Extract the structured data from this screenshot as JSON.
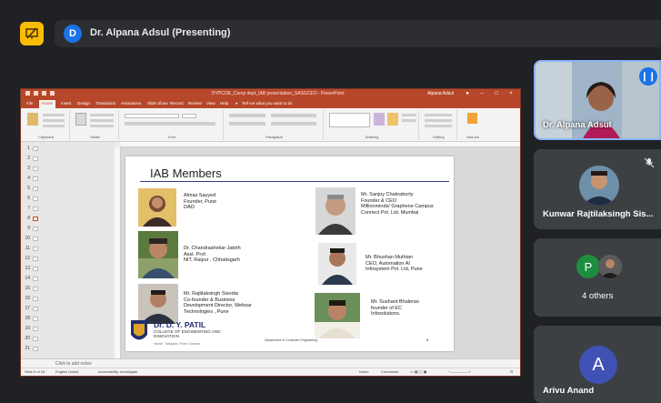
{
  "meeting": {
    "presenter_initial": "D",
    "presenter_label": "Dr. Alpana Adsul (Presenting)",
    "accent_color": "#fbbc04"
  },
  "powerpoint": {
    "title": "DYPCOE_Comp dept_IAB presentation_SASGCEO  -  PowerPoint",
    "user": "Alpana Adsul",
    "tabs": [
      "File",
      "Home",
      "Insert",
      "Design",
      "Transitions",
      "Animations",
      "Slide Show",
      "Record",
      "Review",
      "View",
      "Help",
      "Tell me what you want to do"
    ],
    "ribbon_groups": [
      "Clipboard",
      "Slides",
      "Font",
      "Paragraph",
      "Drawing",
      "Editing",
      "Add-ins"
    ],
    "notes_placeholder": "Click to add notes",
    "status": {
      "slide": "Slide 6 of 18",
      "language": "English (India)",
      "accessibility": "Accessibility: Investigate",
      "notes": "Notes",
      "comments": "Comments"
    },
    "thumbnail_numbers": [
      "1",
      "2",
      "3",
      "4",
      "5",
      "6",
      "7",
      "8",
      "9",
      "10",
      "11",
      "12",
      "13",
      "14",
      "15",
      "16",
      "17",
      "18",
      "19",
      "20",
      "21"
    ]
  },
  "slide": {
    "title": "IAB Members",
    "members_left": [
      {
        "lines": [
          "Almas Sayyed",
          "Founder, Pune",
          "DAO"
        ]
      },
      {
        "lines": [
          "Dr. Chandrashekar Jatoth",
          "Asst. Prof.",
          "NIT, Raipur , Chhatisgarh"
        ]
      },
      {
        "lines": [
          "Mr. Rajtilaksingh Sisodia",
          "Co-founder & Business",
          "Development Director, Websar",
          "Technologies , Pune"
        ]
      }
    ],
    "members_right": [
      {
        "lines": [
          "Mr. Sanjoy Chakraborty",
          "Founder & CEO",
          "Millionminds/ Graphene Campus",
          "Connect Pvt. Ltd, Mumbai"
        ]
      },
      {
        "lines": [
          "Mr. Bhushan Muthian",
          "CEO, Automation AI",
          "Infosystem Pvt. Ltd, Pune"
        ]
      },
      {
        "lines": [
          "Mr. Sushant Bhalerao",
          "founder of EC",
          "Infosolutions."
        ]
      }
    ],
    "college_name": "Dr. D. Y. PATIL",
    "college_sub1": "COLLEGE OF ENGINEERING AND",
    "college_sub2": "INNOVATION",
    "college_place": "Varale, Talegaon, Pune Campus",
    "footer": "Department of Computer Engineering",
    "page_number": "8"
  },
  "participants": [
    {
      "name": "Dr. Alpana Adsul",
      "type": "video"
    },
    {
      "name": "Kunwar Rajtilaksingh Sis...",
      "type": "photo"
    },
    {
      "name": "4 others",
      "initial": "P",
      "initial_color": "#1e8e3e"
    },
    {
      "name": "Arivu Anand",
      "initial": "A",
      "initial_color": "#3f51b5"
    }
  ]
}
